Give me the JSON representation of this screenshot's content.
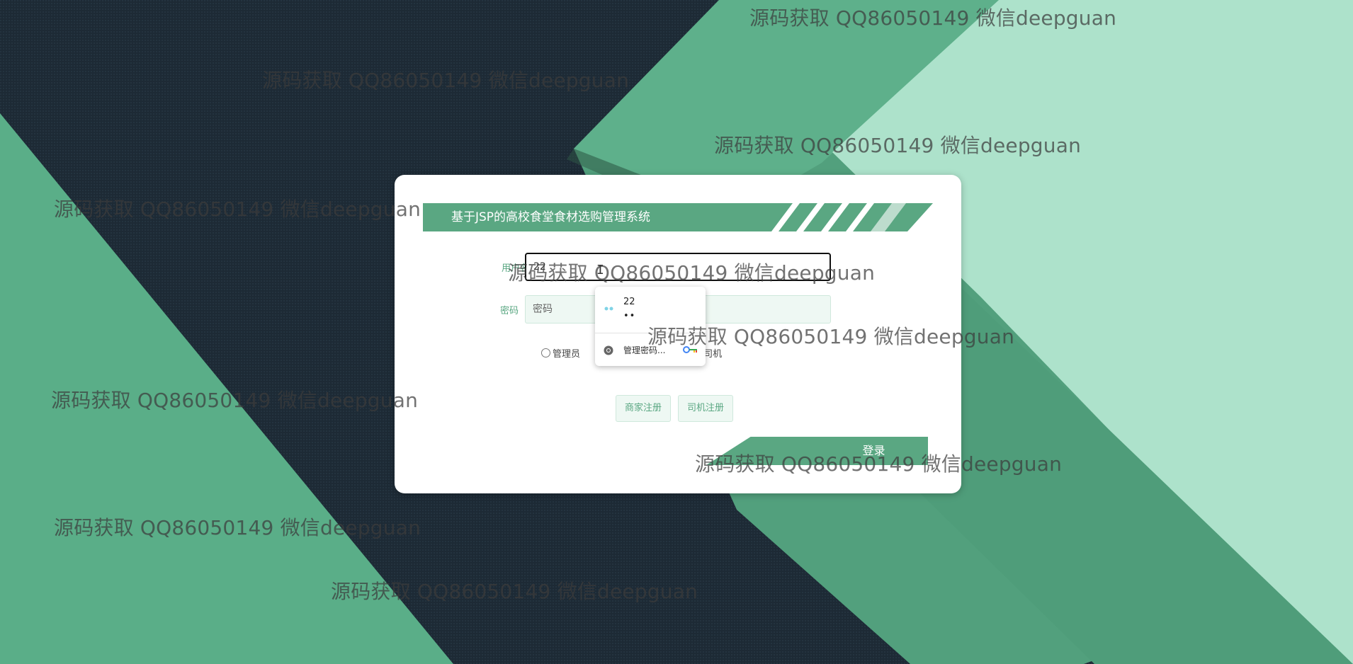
{
  "app": {
    "title": "基于JSP的高校食堂食材选购管理系统"
  },
  "form": {
    "username_label": "用户名",
    "username_value": "22",
    "password_label": "密码",
    "password_placeholder": "密码",
    "roles": [
      {
        "label": "管理员",
        "selected": false
      },
      {
        "label": "司机",
        "selected": false
      }
    ],
    "merchant_register_label": "商家注册",
    "driver_register_label": "司机注册",
    "login_label": "登录"
  },
  "autofill": {
    "username": "22",
    "password_mask": "••",
    "manage_label": "管理密码..."
  },
  "watermark": {
    "text": "源码获取 QQ86050149 微信deepguan"
  },
  "colors": {
    "accent": "#5aa782",
    "light_green": "#a9e0c8",
    "dark_bg": "#1c2833"
  },
  "icons": {
    "key": "key-icon",
    "chrome": "chrome-icon",
    "google_key": "google-key-icon"
  }
}
